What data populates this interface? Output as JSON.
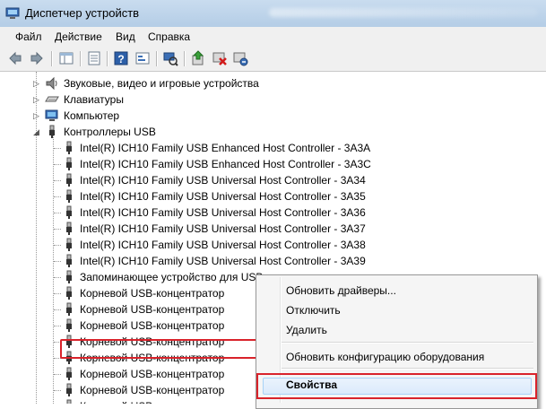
{
  "window": {
    "title": "Диспетчер устройств"
  },
  "menu": [
    "Файл",
    "Действие",
    "Вид",
    "Справка"
  ],
  "toolbar": {
    "icons": [
      "back-arrow-icon",
      "forward-arrow-icon",
      "console-tree-icon",
      "properties-sheet-icon",
      "help-icon",
      "action-pane-icon",
      "scan-hardware-icon",
      "update-driver-icon",
      "disable-device-icon",
      "uninstall-device-icon"
    ]
  },
  "tree": {
    "categories": [
      {
        "label": "Звуковые, видео и игровые устройства",
        "icon": "speaker-icon",
        "state": "collapsed"
      },
      {
        "label": "Клавиатуры",
        "icon": "keyboard-icon",
        "state": "collapsed"
      },
      {
        "label": "Компьютер",
        "icon": "computer-icon",
        "state": "collapsed"
      },
      {
        "label": "Контроллеры USB",
        "icon": "usb-plug-icon",
        "state": "expanded"
      }
    ],
    "usb_children": [
      "Intel(R) ICH10 Family USB Enhanced Host Controller - 3A3A",
      "Intel(R) ICH10 Family USB Enhanced Host Controller - 3A3C",
      "Intel(R) ICH10 Family USB Universal Host Controller - 3A34",
      "Intel(R) ICH10 Family USB Universal Host Controller - 3A35",
      "Intel(R) ICH10 Family USB Universal Host Controller - 3A36",
      "Intel(R) ICH10 Family USB Universal Host Controller - 3A37",
      "Intel(R) ICH10 Family USB Universal Host Controller - 3A38",
      "Intel(R) ICH10 Family USB Universal Host Controller - 3A39",
      "Запоминающее устройство для USB",
      "Корневой USB-концентратор",
      "Корневой USB-концентратор",
      "Корневой USB-концентратор",
      "Корневой USB-концентратор",
      "Корневой USB-концентратор",
      "Корневой USB-концентратор",
      "Корневой USB-концентратор",
      "Корневой USB-концентратор"
    ],
    "selected_item": "Запоминающее устройство для USB"
  },
  "context_menu": {
    "items": [
      {
        "label": "Обновить драйверы..."
      },
      {
        "label": "Отключить"
      },
      {
        "label": "Удалить"
      },
      {
        "label": "Обновить конфигурацию оборудования"
      },
      {
        "label": "Свойства",
        "bold": true,
        "highlighted": true
      }
    ]
  },
  "colors": {
    "annotation_red": "#d9232b",
    "title_bar": "#c9dcef",
    "menu_hover": "#dbeafb"
  }
}
